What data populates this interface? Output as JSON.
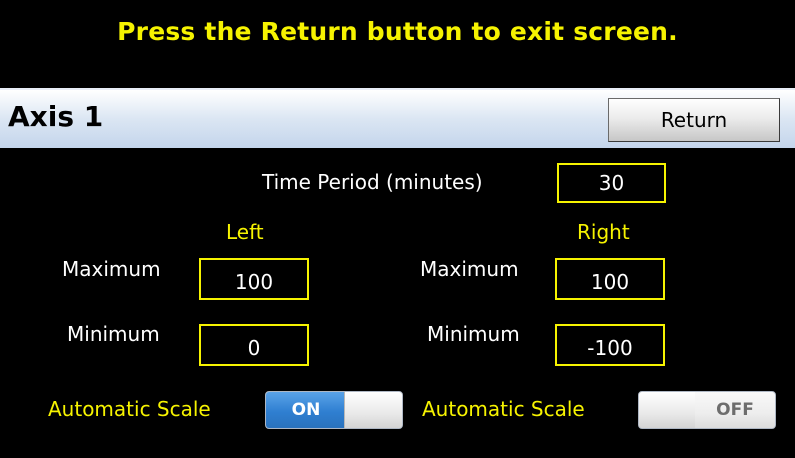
{
  "banner": {
    "message": "Press the Return button to exit screen."
  },
  "header": {
    "title": "Axis 1",
    "return_label": "Return"
  },
  "time_period": {
    "label": "Time Period (minutes)",
    "value": "30"
  },
  "left": {
    "heading": "Left",
    "maximum_label": "Maximum",
    "maximum_value": "100",
    "minimum_label": "Minimum",
    "minimum_value": "0",
    "auto_scale_label": "Automatic Scale",
    "auto_scale_state": "ON"
  },
  "right": {
    "heading": "Right",
    "maximum_label": "Maximum",
    "maximum_value": "100",
    "minimum_label": "Minimum",
    "minimum_value": "-100",
    "auto_scale_label": "Automatic Scale",
    "auto_scale_state": "OFF"
  },
  "colors": {
    "accent_yellow": "#f6f300",
    "background": "#000000",
    "toggle_on": "#2f7fd1"
  }
}
